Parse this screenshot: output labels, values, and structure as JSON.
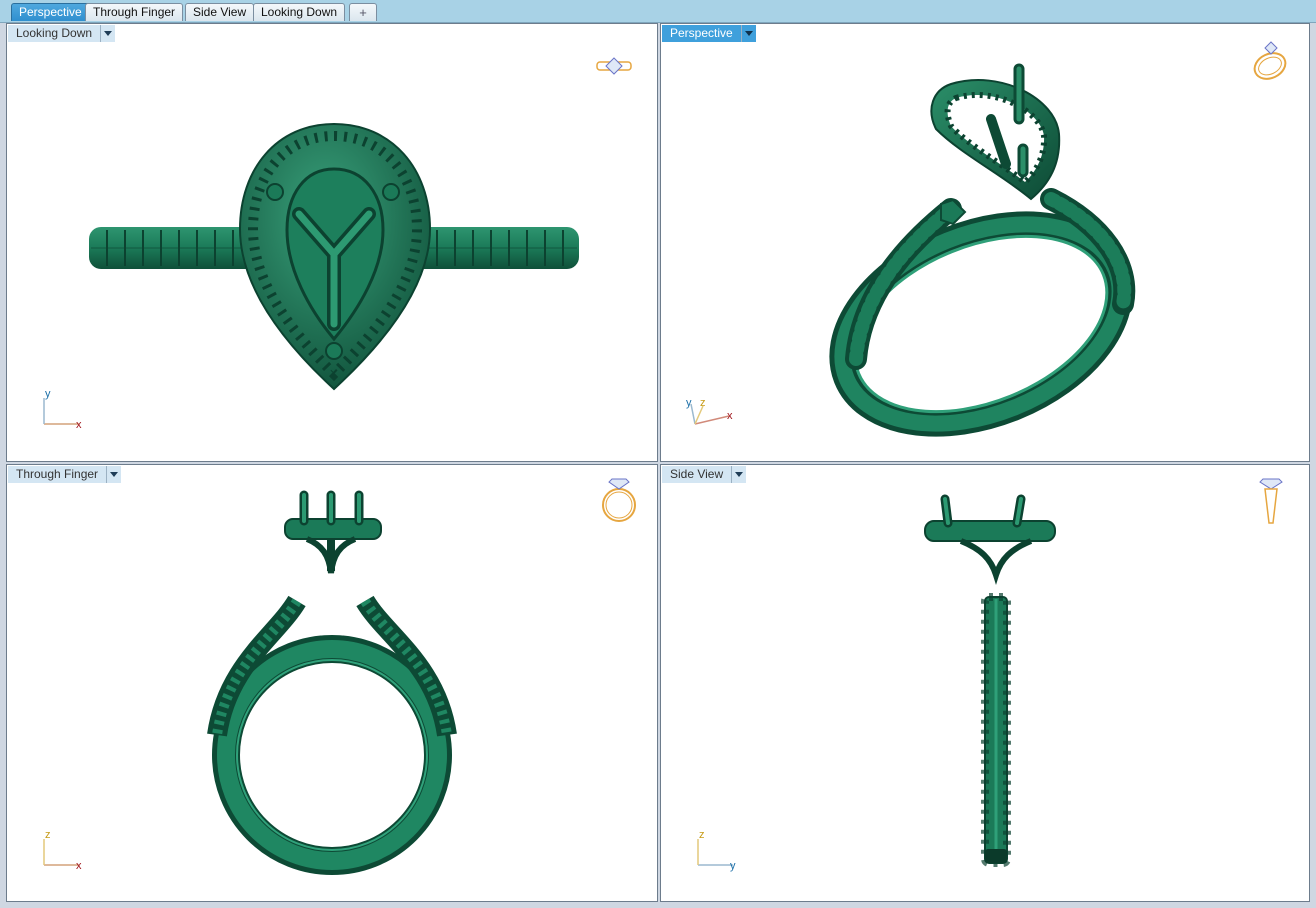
{
  "tabs": [
    {
      "label": "Perspective",
      "active": true
    },
    {
      "label": "Through Finger",
      "active": false
    },
    {
      "label": "Side View",
      "active": false
    },
    {
      "label": "Looking Down",
      "active": false
    }
  ],
  "add_tab_icon": "plus-icon",
  "colors": {
    "model": "#1b7a58",
    "model_dark": "#0f5039",
    "model_light": "#38a07a",
    "axis_x": "#a0141a",
    "axis_y": "#1b6fa8",
    "axis_z": "#c79b16",
    "thumb_gold": "#e6a640",
    "active_label": "#3fa0dc"
  },
  "viewports": {
    "top_left": {
      "label": "Looking Down",
      "axes": [
        "y",
        "x"
      ],
      "thumb_icon": "ring-top-view-icon"
    },
    "top_right": {
      "label": "Perspective",
      "axes": [
        "y",
        "z",
        "x"
      ],
      "thumb_icon": "ring-perspective-icon"
    },
    "bottom_left": {
      "label": "Through Finger",
      "axes": [
        "z",
        "x"
      ],
      "thumb_icon": "ring-front-view-icon"
    },
    "bottom_right": {
      "label": "Side View",
      "axes": [
        "z",
        "y"
      ],
      "thumb_icon": "ring-side-view-icon"
    }
  }
}
